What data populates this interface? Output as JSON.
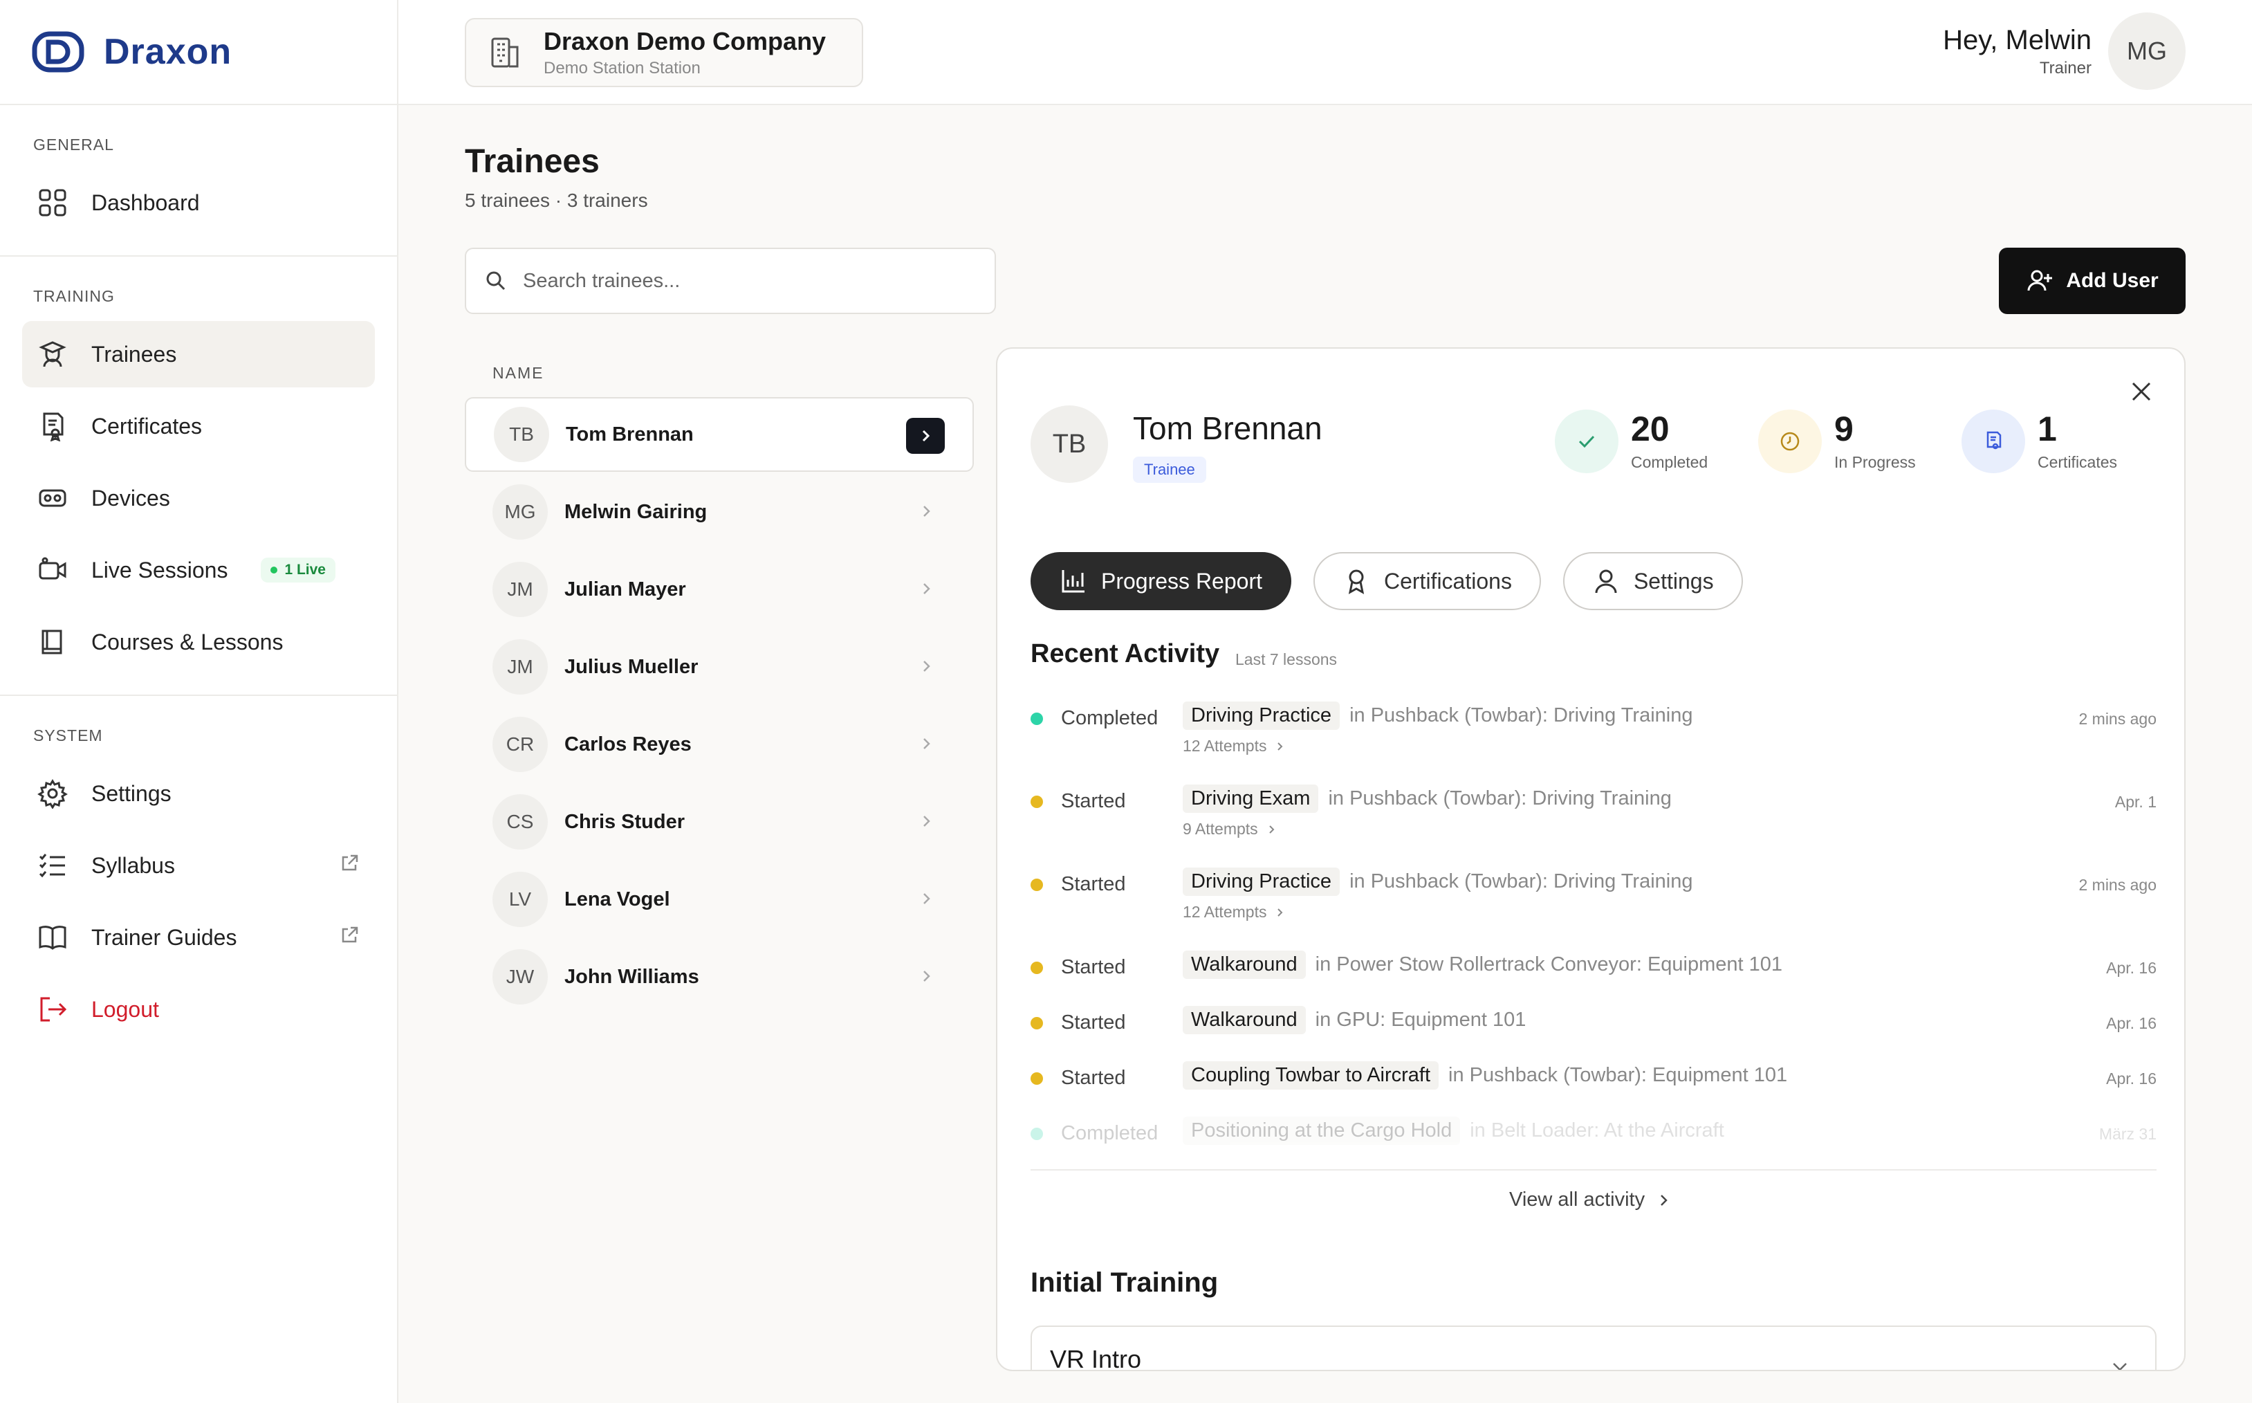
{
  "brand": {
    "name": "Draxon"
  },
  "header": {
    "company_name": "Draxon Demo Company",
    "company_sub": "Demo Station Station",
    "greeting": "Hey, Melwin",
    "role": "Trainer",
    "avatar_initials": "MG"
  },
  "sidebar": {
    "sections": [
      {
        "heading": "GENERAL"
      },
      {
        "heading": "TRAINING"
      },
      {
        "heading": "SYSTEM"
      }
    ],
    "items": [
      {
        "label": "Dashboard",
        "icon": "grid-icon"
      },
      {
        "label": "Trainees",
        "icon": "graduation-icon",
        "active": true
      },
      {
        "label": "Certificates",
        "icon": "certificate-icon"
      },
      {
        "label": "Devices",
        "icon": "vr-headset-icon"
      },
      {
        "label": "Live Sessions",
        "icon": "video-icon",
        "badge": "1 Live"
      },
      {
        "label": "Courses & Lessons",
        "icon": "book-icon"
      },
      {
        "label": "Settings",
        "icon": "gear-icon"
      },
      {
        "label": "Syllabus",
        "icon": "checklist-icon",
        "external": true
      },
      {
        "label": "Trainer Guides",
        "icon": "open-book-icon",
        "external": true
      },
      {
        "label": "Logout",
        "icon": "logout-icon"
      }
    ]
  },
  "main": {
    "title": "Trainees",
    "subtitle": "5 trainees · 3 trainers",
    "search_placeholder": "Search trainees...",
    "add_user_label": "Add User",
    "list_header": "NAME",
    "rows": [
      {
        "initials": "TB",
        "name": "Tom Brennan",
        "selected": true
      },
      {
        "initials": "MG",
        "name": "Melwin Gairing"
      },
      {
        "initials": "JM",
        "name": "Julian Mayer"
      },
      {
        "initials": "JM",
        "name": "Julius Mueller"
      },
      {
        "initials": "CR",
        "name": "Carlos Reyes"
      },
      {
        "initials": "CS",
        "name": "Chris Studer"
      },
      {
        "initials": "LV",
        "name": "Lena Vogel"
      },
      {
        "initials": "JW",
        "name": "John Williams"
      }
    ]
  },
  "detail": {
    "initials": "TB",
    "name": "Tom Brennan",
    "role": "Trainee",
    "stats": [
      {
        "value": "20",
        "label": "Completed",
        "icon": "check-icon",
        "color": "#e8f7f1"
      },
      {
        "value": "9",
        "label": "In Progress",
        "icon": "clock-icon",
        "color": "#fdf6e3"
      },
      {
        "value": "1",
        "label": "Certificates",
        "icon": "certificate-icon",
        "color": "#e8eefc"
      }
    ],
    "tabs": [
      {
        "label": "Progress Report",
        "icon": "chart-icon",
        "active": true
      },
      {
        "label": "Certifications",
        "icon": "award-icon"
      },
      {
        "label": "Settings",
        "icon": "user-icon"
      }
    ],
    "recent_title": "Recent Activity",
    "recent_sub": "Last 7 lessons",
    "activity": [
      {
        "status": "Completed",
        "lesson": "Driving Practice",
        "course": "in Pushback (Towbar): Driving Training",
        "attempts": "12 Attempts",
        "time": "2 mins ago",
        "color": "#2dd4a8"
      },
      {
        "status": "Started",
        "lesson": "Driving Exam",
        "course": "in Pushback (Towbar): Driving Training",
        "attempts": "9 Attempts",
        "time": "Apr. 1",
        "color": "#e6b820"
      },
      {
        "status": "Started",
        "lesson": "Driving Practice",
        "course": "in Pushback (Towbar): Driving Training",
        "attempts": "12 Attempts",
        "time": "2 mins ago",
        "color": "#e6b820"
      },
      {
        "status": "Started",
        "lesson": "Walkaround",
        "course": "in Power Stow Rollertrack Conveyor: Equipment 101",
        "attempts": "",
        "time": "Apr. 16",
        "color": "#e6b820"
      },
      {
        "status": "Started",
        "lesson": "Walkaround",
        "course": "in GPU: Equipment 101",
        "attempts": "",
        "time": "Apr. 16",
        "color": "#e6b820"
      },
      {
        "status": "Started",
        "lesson": "Coupling Towbar to Aircraft",
        "course": "in Pushback (Towbar): Equipment 101",
        "attempts": "",
        "time": "Apr. 16",
        "color": "#e6b820"
      },
      {
        "status": "Completed",
        "lesson": "Positioning at the Cargo Hold",
        "course": "in Belt Loader: At the Aircraft",
        "attempts": "",
        "time": "März 31",
        "color": "#2dd4a8"
      }
    ],
    "view_all": "View all activity",
    "initial_training_title": "Initial Training",
    "vr_intro": "VR Intro"
  }
}
